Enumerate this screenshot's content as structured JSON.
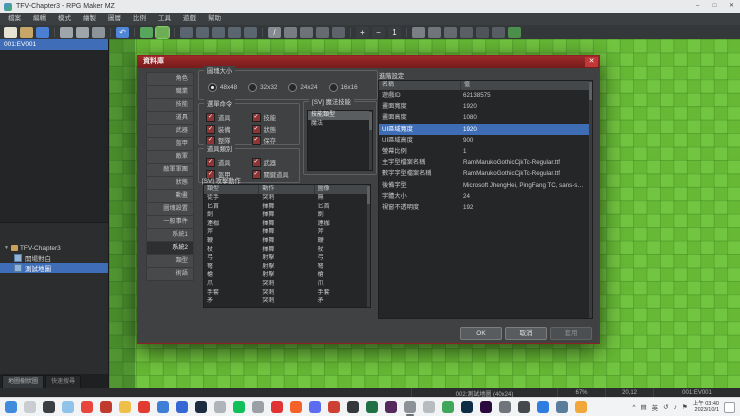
{
  "window": {
    "title": "TFV-Chapter3 - RPG Maker MZ",
    "controls": [
      {
        "name": "minimize-button",
        "glyph": "–"
      },
      {
        "name": "maximize-button",
        "glyph": "□"
      },
      {
        "name": "close-button",
        "glyph": "✕"
      }
    ]
  },
  "menu": {
    "items": [
      "檔案",
      "編輯",
      "模式",
      "繪製",
      "圖層",
      "比例",
      "工具",
      "遊戲",
      "幫助"
    ]
  },
  "toolbar": {
    "icons": [
      {
        "n": "new-file-icon",
        "c": "#e6e2d4"
      },
      {
        "n": "open-folder-icon",
        "c": "#c7a768"
      },
      {
        "n": "save-icon",
        "c": "#4a7fd4"
      },
      {
        "sep": 1
      },
      {
        "n": "cut-icon",
        "c": "#7d8destroy"
      },
      {
        "n": "copy-icon",
        "c": "#9fa6ab"
      },
      {
        "n": "paste-icon",
        "c": "#8d9499"
      },
      {
        "sep": 1
      },
      {
        "n": "undo-icon",
        "c": "#4f86d8",
        "g": "↶"
      },
      {
        "sep": 1
      },
      {
        "n": "map-mode-icon",
        "c": "#57a85c"
      },
      {
        "n": "event-mode-icon",
        "c": "#6fae56",
        "sel": 1
      },
      {
        "sep": 1
      },
      {
        "n": "pencil-tool-icon",
        "c": "#5c6670"
      },
      {
        "n": "rectangle-tool-icon",
        "c": "#5c6670"
      },
      {
        "n": "ellipse-tool-icon",
        "c": "#5c6670"
      },
      {
        "n": "fill-tool-icon",
        "c": "#5c6670"
      },
      {
        "n": "shadow-tool-icon",
        "c": "#5c6670"
      },
      {
        "sep": 1
      },
      {
        "n": "line-tool-icon",
        "c": "#868c92",
        "g": "/"
      },
      {
        "n": "dot-tool-icon",
        "c": "#787e84"
      },
      {
        "n": "eraser-tool-icon",
        "c": "#6e747a"
      },
      {
        "n": "select-tool-icon",
        "c": "#666c72"
      },
      {
        "n": "angle-tool-icon",
        "c": "#5e646a"
      },
      {
        "sep": 1
      },
      {
        "n": "zoom-in-icon",
        "c": "#3b3e40",
        "g": "+"
      },
      {
        "n": "zoom-out-icon",
        "c": "#3b3e40",
        "g": "−"
      },
      {
        "n": "zoom-actual-icon",
        "c": "#3b3e40",
        "g": "1"
      },
      {
        "sep": 1
      },
      {
        "n": "database-icon",
        "c": "#7b8187"
      },
      {
        "n": "resource-manager-icon",
        "c": "#70767c"
      },
      {
        "n": "plugin-manager-icon",
        "c": "#656b71"
      },
      {
        "n": "sound-test-icon",
        "c": "#5a6066"
      },
      {
        "n": "event-search-icon",
        "c": "#4f555b"
      },
      {
        "n": "character-generator-icon",
        "c": "#585e64"
      },
      {
        "n": "playtest-icon",
        "c": "#4d8f4d"
      }
    ]
  },
  "palette": {
    "selected_event": "001:EV001"
  },
  "map_tree": {
    "root": "TFV-Chapter3",
    "items": [
      {
        "label": "開場對白",
        "selected": false
      },
      {
        "label": "測試地圖",
        "selected": true
      }
    ],
    "tabs": [
      {
        "label": "地圖樹狀圖",
        "selected": true
      },
      {
        "label": "快速搜尋",
        "selected": false
      }
    ]
  },
  "dialog": {
    "title": "資料庫",
    "close_glyph": "✕",
    "tabs": [
      "角色",
      "職業",
      "技能",
      "道具",
      "武器",
      "盔甲",
      "敵軍",
      "敵軍軍團",
      "狀態",
      "動畫",
      "圖塊設置",
      "一般事件",
      "系統1",
      "系統2",
      "類型",
      "術語"
    ],
    "selected_tab": "系統2",
    "tile_size": {
      "label": "圖塊大小",
      "options": [
        "48x48",
        "32x32",
        "24x24",
        "16x16"
      ],
      "selected": "48x48"
    },
    "menu_commands": {
      "label": "選單命令",
      "items": [
        "道具",
        "技能",
        "裝備",
        "狀態",
        "整隊",
        "保存"
      ],
      "check_glyph": "✓"
    },
    "item_categories": {
      "label": "道具類別",
      "items": [
        "道具",
        "武器",
        "盔甲",
        "關鍵道具"
      ]
    },
    "sv_magic": {
      "label": "[SV] 魔法技能",
      "header": "技能類型",
      "rows": [
        "魔法"
      ]
    },
    "sv_motions": {
      "label": "[SV] 攻擊動作",
      "columns": [
        "類型",
        "動作",
        "圖像"
      ],
      "rows": [
        [
          "徒手",
          "突刺",
          "無"
        ],
        [
          "匕首",
          "揮舞",
          "匕首"
        ],
        [
          "劍",
          "揮舞",
          "劍"
        ],
        [
          "連枷",
          "揮舞",
          "連枷"
        ],
        [
          "斧",
          "揮舞",
          "斧"
        ],
        [
          "鞭",
          "揮舞",
          "鞭"
        ],
        [
          "杖",
          "揮舞",
          "杖"
        ],
        [
          "弓",
          "射擊",
          "弓"
        ],
        [
          "弩",
          "射擊",
          "弩"
        ],
        [
          "槍",
          "射擊",
          "槍"
        ],
        [
          "爪",
          "突刺",
          "爪"
        ],
        [
          "手套",
          "突刺",
          "手套"
        ],
        [
          "矛",
          "突刺",
          "矛"
        ]
      ]
    },
    "advanced": {
      "label": "進階設定",
      "columns": [
        "名稱",
        "值"
      ],
      "selected_row": 3,
      "rows": [
        [
          "遊戲ID",
          "62138575"
        ],
        [
          "畫面寬度",
          "1920"
        ],
        [
          "畫面高度",
          "1080"
        ],
        [
          "UI區域寬度",
          "1920"
        ],
        [
          "UI區域高度",
          "900"
        ],
        [
          "螢幕比例",
          "1"
        ],
        [
          "主字型檔案名稱",
          "RamMarukoGothicCjkTc-Regular.ttf"
        ],
        [
          "數字字型檔案名稱",
          "RamMarukoGothicCjkTc-Regular.ttf"
        ],
        [
          "後備字型",
          "Microsoft JhengHei, PingFang TC, sans-s…"
        ],
        [
          "字體大小",
          "24"
        ],
        [
          "視窗不透明度",
          "192"
        ]
      ]
    },
    "buttons": {
      "ok": "OK",
      "cancel": "取消",
      "apply": "套用"
    }
  },
  "status_bar": {
    "map_info": "002:測試地圖 (40x24)",
    "zoom": "67%",
    "coords": "20,12",
    "event": "001:EV001"
  },
  "taskbar": {
    "apps": [
      {
        "n": "start-button",
        "c": "#3f8cdc"
      },
      {
        "n": "search-icon",
        "c": "#c9cdd2"
      },
      {
        "n": "taskbar-app-1",
        "c": "#3b3f44"
      },
      {
        "n": "taskbar-app-2",
        "c": "#8fc3ea"
      },
      {
        "n": "taskbar-app-3",
        "c": "#e8453c"
      },
      {
        "n": "taskbar-app-4",
        "c": "#c03a2e"
      },
      {
        "n": "taskbar-app-5",
        "c": "#eec04a"
      },
      {
        "n": "taskbar-app-6",
        "c": "#e23b30"
      },
      {
        "n": "taskbar-app-7",
        "c": "#3e7ed6"
      },
      {
        "n": "taskbar-app-8",
        "c": "#3568d4"
      },
      {
        "n": "taskbar-app-9",
        "c": "#1d2c3f"
      },
      {
        "n": "taskbar-app-10",
        "c": "#aeb4ba"
      },
      {
        "n": "taskbar-app-11",
        "c": "#12c05a"
      },
      {
        "n": "taskbar-app-12",
        "c": "#9aa0a6"
      },
      {
        "n": "taskbar-app-13",
        "c": "#e03434"
      },
      {
        "n": "taskbar-app-14",
        "c": "#f4622a"
      },
      {
        "n": "taskbar-app-15",
        "c": "#5b6cf0"
      },
      {
        "n": "taskbar-app-16",
        "c": "#cf4034"
      },
      {
        "n": "taskbar-app-17",
        "c": "#34383c"
      },
      {
        "n": "taskbar-app-18",
        "c": "#1f7145"
      },
      {
        "n": "taskbar-app-19",
        "c": "#55285e"
      },
      {
        "n": "taskbar-app-20",
        "c": "#8d9298",
        "active": 1
      },
      {
        "n": "taskbar-app-21",
        "c": "#b7bcc1"
      },
      {
        "n": "taskbar-app-22",
        "c": "#3fa65b"
      },
      {
        "n": "taskbar-app-23",
        "c": "#0f2c47"
      },
      {
        "n": "taskbar-app-24",
        "c": "#2a0a3d"
      },
      {
        "n": "taskbar-app-25",
        "c": "#6f757b"
      },
      {
        "n": "taskbar-app-26",
        "c": "#45494e"
      },
      {
        "n": "taskbar-app-27",
        "c": "#2f7de0"
      },
      {
        "n": "taskbar-app-28",
        "c": "#5a7d9a"
      },
      {
        "n": "taskbar-app-29",
        "c": "#f2a73b"
      }
    ],
    "tray": {
      "glyphs": [
        {
          "n": "tray-expand-icon",
          "g": "^"
        },
        {
          "n": "tray-keyboard-icon",
          "g": "▤"
        },
        {
          "n": "ime-language-indicator",
          "g": "英"
        },
        {
          "n": "tray-sync-icon",
          "g": "↺"
        },
        {
          "n": "tray-volume-icon",
          "g": "♪"
        },
        {
          "n": "tray-flag-icon",
          "g": "⚑"
        }
      ],
      "time": "上午 03:40",
      "date": "2023/10/1"
    }
  }
}
